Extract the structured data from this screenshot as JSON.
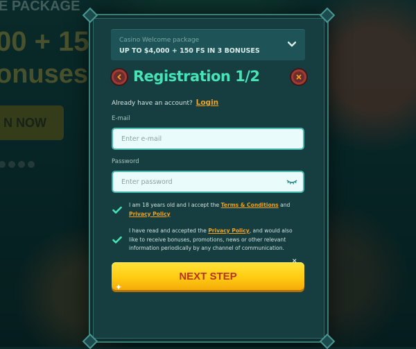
{
  "background": {
    "package_text": "E PACKAGE",
    "amount_text": "00 + 15",
    "bonuses_text": "onuses",
    "button_text": "N NOW"
  },
  "package": {
    "title": "Casino Welcome package",
    "description": "UP TO $4,000 + 150 FS IN 3 BONUSES"
  },
  "header": {
    "title": "Registration 1/2"
  },
  "login": {
    "prompt": "Already have an account?",
    "link": "Login"
  },
  "form": {
    "email_label": "E-mail",
    "email_placeholder": "Enter e-mail",
    "email_value": "",
    "password_label": "Password",
    "password_placeholder": "Enter password",
    "password_value": ""
  },
  "consents": {
    "age": {
      "checked": true,
      "text_before": "I am 18 years old and I accept the",
      "terms_link": "Terms & Conditions",
      "text_mid": "and",
      "privacy_link": "Privacy Policy"
    },
    "marketing": {
      "checked": true,
      "text_before": "I have read and accepted the",
      "privacy_link": "Privacy Policy",
      "text_after": ", and would also like to receive bonuses, promotions, news or other relevant information periodically by any channel of communication."
    }
  },
  "next_button": "NEXT STEP",
  "colors": {
    "accent_title": "#46e3b6",
    "link": "#f0a220",
    "button": "#ffcc10",
    "button_text": "#b8321a",
    "close": "#a23b36"
  },
  "icons": [
    "chevron-left-icon",
    "close-icon",
    "chevron-down-icon",
    "eye-icon",
    "checkmark-icon",
    "sparkle-icon"
  ]
}
